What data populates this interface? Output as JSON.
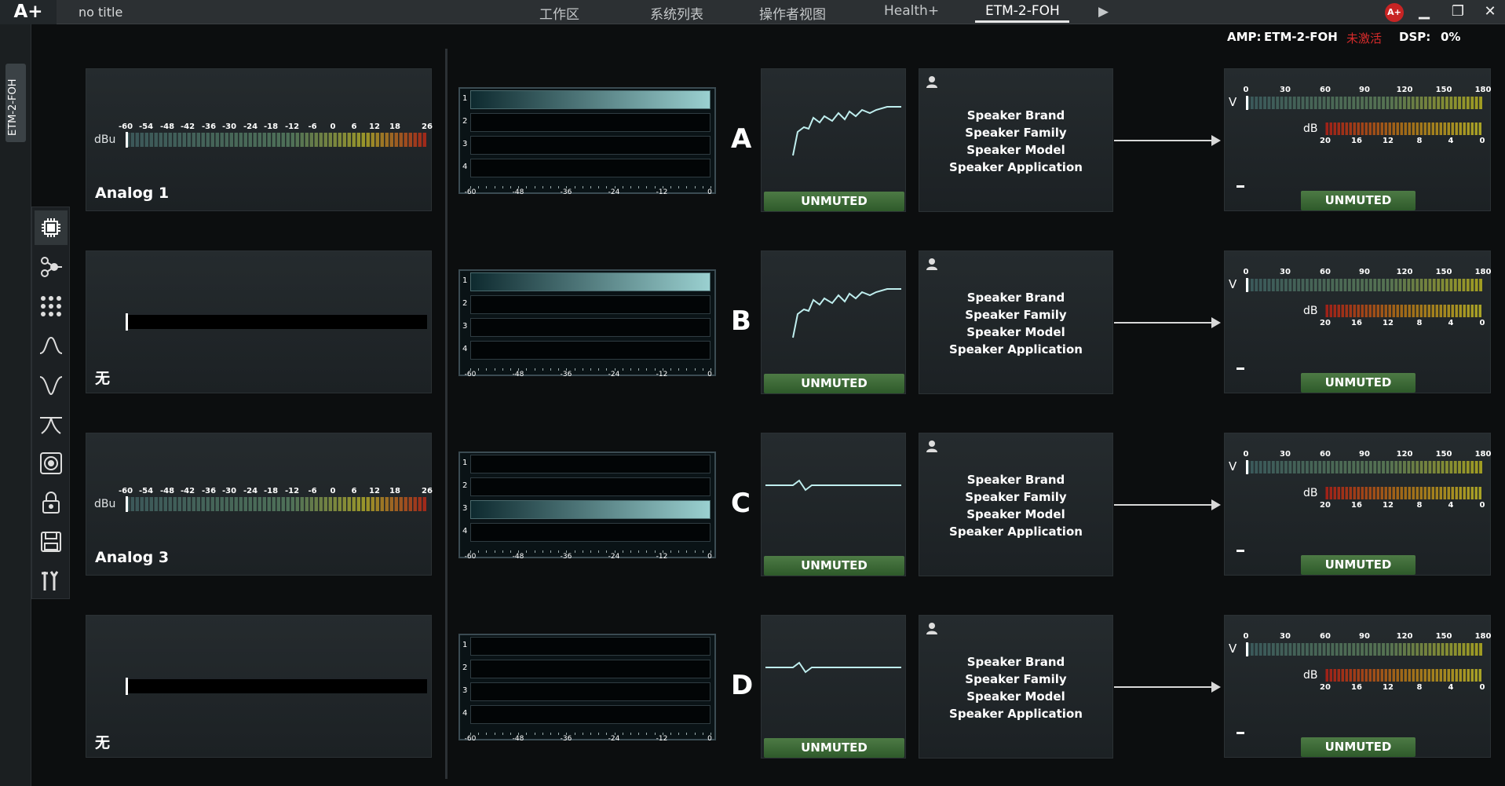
{
  "titlebar": {
    "logo": "A+",
    "doc_title": "no title",
    "tabs": [
      "工作区",
      "系统列表",
      "操作者视图",
      "Health+",
      "ETM-2-FOH"
    ],
    "active_tab": "ETM-2-FOH",
    "play_symbol": "▶",
    "badge": "A+",
    "minimize": "▁",
    "restore": "❐",
    "close": "✕"
  },
  "status": {
    "amp_label": "AMP:",
    "amp_name": "ETM-2-FOH",
    "activation": "未激活",
    "dsp_label": "DSP:",
    "dsp_value": "0%"
  },
  "device_tab": "ETM-2-FOH",
  "toolbar": {
    "items": [
      "processor-icon",
      "routing-icon",
      "grid-icon",
      "eq-peak-icon",
      "eq-notch-icon",
      "filter-icon",
      "speaker-icon",
      "lock-icon",
      "save-icon",
      "tools-icon"
    ]
  },
  "input_meter": {
    "unit": "dBu",
    "ticks": [
      "-60",
      "-54",
      "-48",
      "-42",
      "-36",
      "-30",
      "-24",
      "-18",
      "-12",
      "-6",
      "0",
      "6",
      "12",
      "18",
      "26"
    ]
  },
  "inputs": [
    {
      "name": "Analog 1",
      "has_meter": true
    },
    {
      "name": "无",
      "has_meter": false
    },
    {
      "name": "Analog 3",
      "has_meter": true
    },
    {
      "name": "无",
      "has_meter": false
    }
  ],
  "matrix": {
    "rows": [
      "1",
      "2",
      "3",
      "4"
    ],
    "scale": [
      "-60",
      "-48",
      "-36",
      "-24",
      "-12",
      "0"
    ],
    "active_rows": [
      1,
      1,
      3,
      0
    ]
  },
  "channels": [
    {
      "letter": "A",
      "eq_state": "UNMUTED",
      "eq_curve": "shaped",
      "out_state": "UNMUTED"
    },
    {
      "letter": "B",
      "eq_state": "UNMUTED",
      "eq_curve": "shaped",
      "out_state": "UNMUTED"
    },
    {
      "letter": "C",
      "eq_state": "UNMUTED",
      "eq_curve": "flat",
      "out_state": "UNMUTED"
    },
    {
      "letter": "D",
      "eq_state": "UNMUTED",
      "eq_curve": "flat",
      "out_state": "UNMUTED"
    }
  ],
  "speaker": {
    "lines": [
      "Speaker Brand",
      "Speaker Family",
      "Speaker Model",
      "Speaker Application"
    ]
  },
  "output_meter": {
    "v_label": "V",
    "v_ticks": [
      "0",
      "30",
      "60",
      "90",
      "120",
      "150",
      "180"
    ],
    "db_label": "dB",
    "db_ticks": [
      "20",
      "16",
      "12",
      "8",
      "4",
      "0"
    ],
    "dash": "–"
  },
  "colors": {
    "accent_green": "#3f6d3a",
    "warn_red": "#d62b2b",
    "meter_teal": "#9ad0d0"
  }
}
